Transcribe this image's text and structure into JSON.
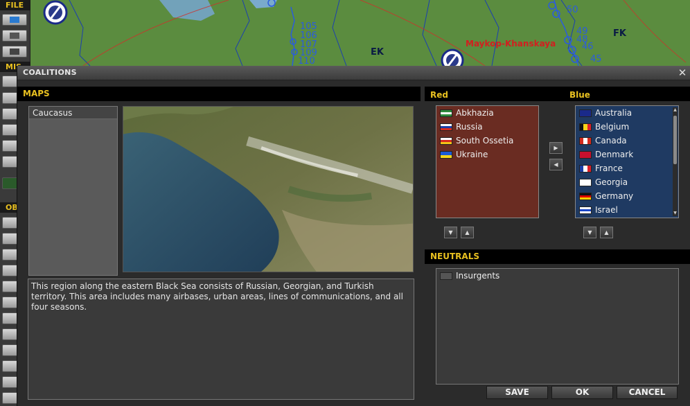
{
  "background": {
    "toolbar_sections": [
      "FILE",
      "MIS",
      "OB"
    ],
    "map_labels": {
      "numbers": [
        "105",
        "106",
        "107",
        "109",
        "110",
        "49",
        "48",
        "46",
        "45",
        "50"
      ],
      "grid": [
        "EK",
        "FK"
      ],
      "place": "Maykop-Khanskaya"
    }
  },
  "dialog": {
    "title": "COALITIONS",
    "maps": {
      "header": "MAPS",
      "items": [
        "Caucasus"
      ],
      "description": "This region along the eastern Black Sea consists of Russian, Georgian, and Turkish territory. This area includes many airbases, urban areas, lines of communications, and all four seasons."
    },
    "red": {
      "label": "Red",
      "countries": [
        {
          "name": "Abkhazia",
          "flag": [
            "#2e8b3c",
            "#ffffff",
            "#2e8b3c"
          ]
        },
        {
          "name": "Russia",
          "flag": [
            "#ffffff",
            "#1c3fa8",
            "#d52b1e"
          ]
        },
        {
          "name": "South Ossetia",
          "flag": [
            "#ffffff",
            "#d52b1e",
            "#f2c318"
          ]
        },
        {
          "name": "Ukraine",
          "flag": [
            "#1a5bd6",
            "#f7d417"
          ]
        }
      ]
    },
    "blue": {
      "label": "Blue",
      "countries": [
        {
          "name": "Australia",
          "flag": [
            "#1a2a8a"
          ]
        },
        {
          "name": "Belgium",
          "flag": [
            "#111111",
            "#f5d31a",
            "#e0202a"
          ],
          "vertical": true
        },
        {
          "name": "Canada",
          "flag": [
            "#d52b1e",
            "#ffffff",
            "#d52b1e"
          ],
          "vertical": true
        },
        {
          "name": "Denmark",
          "flag": [
            "#c8102e"
          ]
        },
        {
          "name": "France",
          "flag": [
            "#1b3fa8",
            "#ffffff",
            "#e0202a"
          ],
          "vertical": true
        },
        {
          "name": "Georgia",
          "flag": [
            "#ffffff"
          ]
        },
        {
          "name": "Germany",
          "flag": [
            "#111111",
            "#dd0000",
            "#ffce00"
          ]
        },
        {
          "name": "Israel",
          "flag": [
            "#ffffff",
            "#1a46c9",
            "#ffffff"
          ]
        }
      ]
    },
    "neutrals": {
      "header": "NEUTRALS",
      "items": [
        {
          "name": "Insurgents"
        }
      ]
    },
    "buttons": {
      "save": "SAVE",
      "ok": "OK",
      "cancel": "CANCEL"
    }
  },
  "colors": {
    "accent": "#e8c020",
    "red_bg": "#6a2c22",
    "blue_bg": "#1f3a62"
  }
}
